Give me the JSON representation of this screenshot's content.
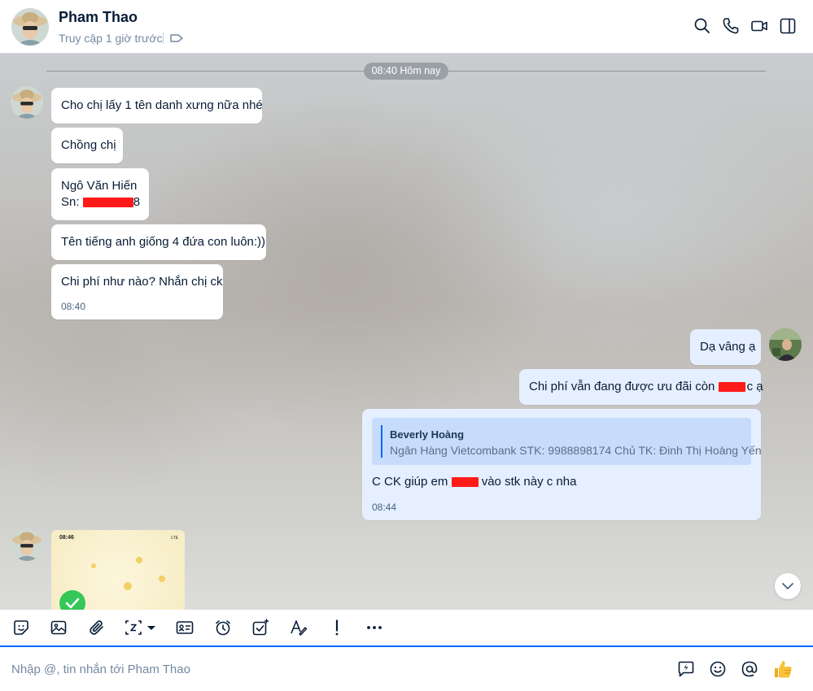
{
  "header": {
    "contact_name": "Pham Thao",
    "status": "Truy cập 1 giờ trước",
    "icons": [
      "search-icon",
      "phone-icon",
      "video-call-icon",
      "side-panel-icon",
      "tag-icon"
    ]
  },
  "chat": {
    "date_divider": "08:40 Hôm nay",
    "incoming": [
      {
        "text": "Cho chị lấy 1 tên danh xưng nữa nhé"
      },
      {
        "text": "Chồng chị"
      },
      {
        "line1": "Ngô Văn Hiến",
        "line2_prefix": "Sn: ",
        "line2_suffix": "8"
      },
      {
        "text": "Tên tiếng anh giống 4 đứa con luôn:))"
      },
      {
        "text": "Chi phí như nào? Nhắn chị ck",
        "time": "08:40"
      }
    ],
    "outgoing": [
      {
        "text": "Dạ vâng ạ"
      },
      {
        "prefix": "Chi phí vẫn đang được ưu đãi còn ",
        "suffix": "c ạ"
      },
      {
        "quote_author": "Beverly Hoàng",
        "quote_text": "Ngân Hàng Vietcombank STK: 9988898174 Chủ TK: Đinh Thị Hoàng Yến",
        "prefix": "C CK giúp em ",
        "suffix": " vào stk này c nha",
        "time": "08:44"
      }
    ],
    "image_message": {
      "screen_time": "08:46",
      "screen_status": "LTE"
    }
  },
  "composer": {
    "placeholder": "Nhập @, tin nhắn tới Pham Thao"
  },
  "colors": {
    "accent": "#0068ff",
    "outgoing_bubble": "#e5efff",
    "incoming_bubble": "#ffffff",
    "redaction": "#ff1a1a"
  }
}
